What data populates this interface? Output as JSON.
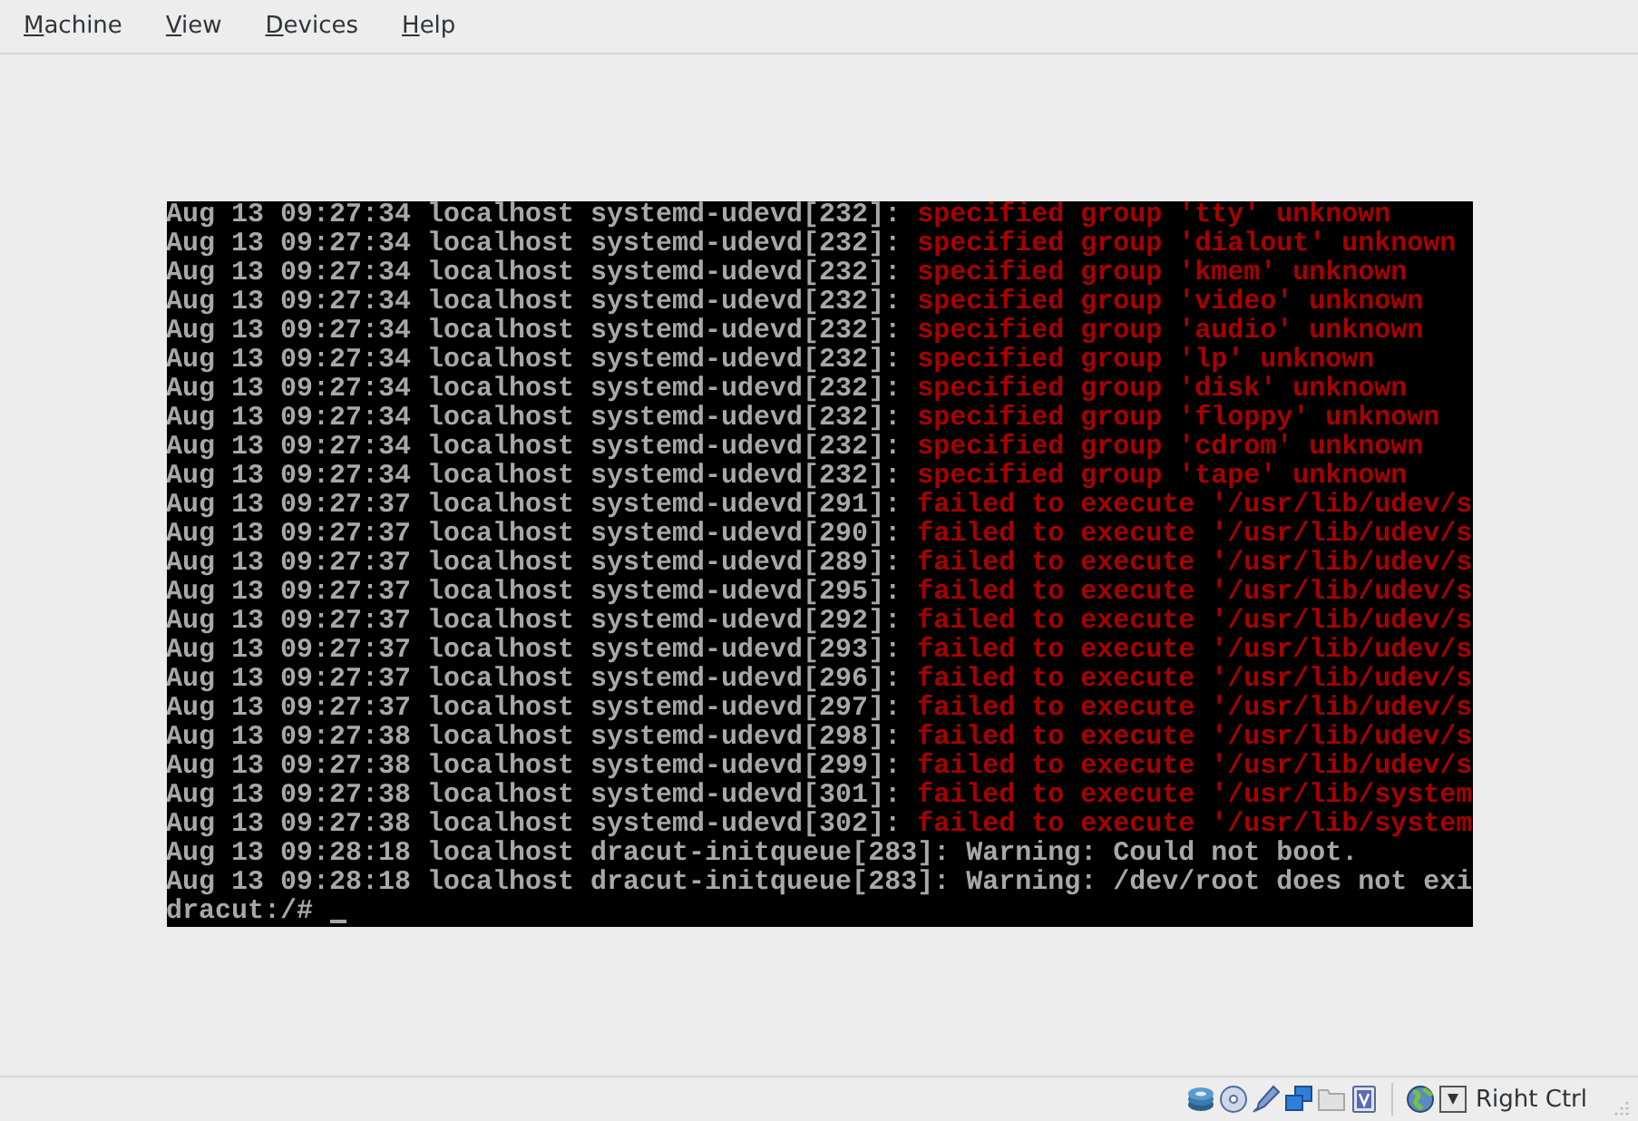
{
  "menu_bar": [
    {
      "label": "Machine"
    },
    {
      "label": "View"
    },
    {
      "label": "Devices"
    },
    {
      "label": "Help"
    }
  ],
  "console": {
    "lines": [
      {
        "prefix": "Aug 13 09:27:34 localhost systemd-udevd[232]:",
        "message": "specified group 'tty' unknown",
        "kind": "error"
      },
      {
        "prefix": "Aug 13 09:27:34 localhost systemd-udevd[232]:",
        "message": "specified group 'dialout' unknown",
        "kind": "error"
      },
      {
        "prefix": "Aug 13 09:27:34 localhost systemd-udevd[232]:",
        "message": "specified group 'kmem' unknown",
        "kind": "error"
      },
      {
        "prefix": "Aug 13 09:27:34 localhost systemd-udevd[232]:",
        "message": "specified group 'video' unknown",
        "kind": "error"
      },
      {
        "prefix": "Aug 13 09:27:34 localhost systemd-udevd[232]:",
        "message": "specified group 'audio' unknown",
        "kind": "error"
      },
      {
        "prefix": "Aug 13 09:27:34 localhost systemd-udevd[232]:",
        "message": "specified group 'lp' unknown",
        "kind": "error"
      },
      {
        "prefix": "Aug 13 09:27:34 localhost systemd-udevd[232]:",
        "message": "specified group 'disk' unknown",
        "kind": "error"
      },
      {
        "prefix": "Aug 13 09:27:34 localhost systemd-udevd[232]:",
        "message": "specified group 'floppy' unknown",
        "kind": "error"
      },
      {
        "prefix": "Aug 13 09:27:34 localhost systemd-udevd[232]:",
        "message": "specified group 'cdrom' unknown",
        "kind": "error"
      },
      {
        "prefix": "Aug 13 09:27:34 localhost systemd-udevd[232]:",
        "message": "specified group 'tape' unknown",
        "kind": "error"
      },
      {
        "prefix": "Aug 13 09:27:37 localhost systemd-udevd[291]:",
        "message": "failed to execute '/usr/lib/udev/s",
        "kind": "error"
      },
      {
        "prefix": "Aug 13 09:27:37 localhost systemd-udevd[290]:",
        "message": "failed to execute '/usr/lib/udev/s",
        "kind": "error"
      },
      {
        "prefix": "Aug 13 09:27:37 localhost systemd-udevd[289]:",
        "message": "failed to execute '/usr/lib/udev/s",
        "kind": "error"
      },
      {
        "prefix": "Aug 13 09:27:37 localhost systemd-udevd[295]:",
        "message": "failed to execute '/usr/lib/udev/s",
        "kind": "error"
      },
      {
        "prefix": "Aug 13 09:27:37 localhost systemd-udevd[292]:",
        "message": "failed to execute '/usr/lib/udev/s",
        "kind": "error"
      },
      {
        "prefix": "Aug 13 09:27:37 localhost systemd-udevd[293]:",
        "message": "failed to execute '/usr/lib/udev/s",
        "kind": "error"
      },
      {
        "prefix": "Aug 13 09:27:37 localhost systemd-udevd[296]:",
        "message": "failed to execute '/usr/lib/udev/s",
        "kind": "error"
      },
      {
        "prefix": "Aug 13 09:27:37 localhost systemd-udevd[297]:",
        "message": "failed to execute '/usr/lib/udev/s",
        "kind": "error"
      },
      {
        "prefix": "Aug 13 09:27:38 localhost systemd-udevd[298]:",
        "message": "failed to execute '/usr/lib/udev/s",
        "kind": "error"
      },
      {
        "prefix": "Aug 13 09:27:38 localhost systemd-udevd[299]:",
        "message": "failed to execute '/usr/lib/udev/s",
        "kind": "error"
      },
      {
        "prefix": "Aug 13 09:27:38 localhost systemd-udevd[301]:",
        "message": "failed to execute '/usr/lib/system",
        "kind": "error"
      },
      {
        "prefix": "Aug 13 09:27:38 localhost systemd-udevd[302]:",
        "message": "failed to execute '/usr/lib/system",
        "kind": "error"
      },
      {
        "prefix": "Aug 13 09:28:18 localhost dracut-initqueue[283]:",
        "message": "Warning: Could not boot.",
        "kind": "normal"
      },
      {
        "prefix": "Aug 13 09:28:18 localhost dracut-initqueue[283]:",
        "message": "Warning: /dev/root does not exi",
        "kind": "normal"
      }
    ],
    "prompt": "dracut:/#"
  },
  "status_bar": {
    "host_key": "Right Ctrl"
  }
}
